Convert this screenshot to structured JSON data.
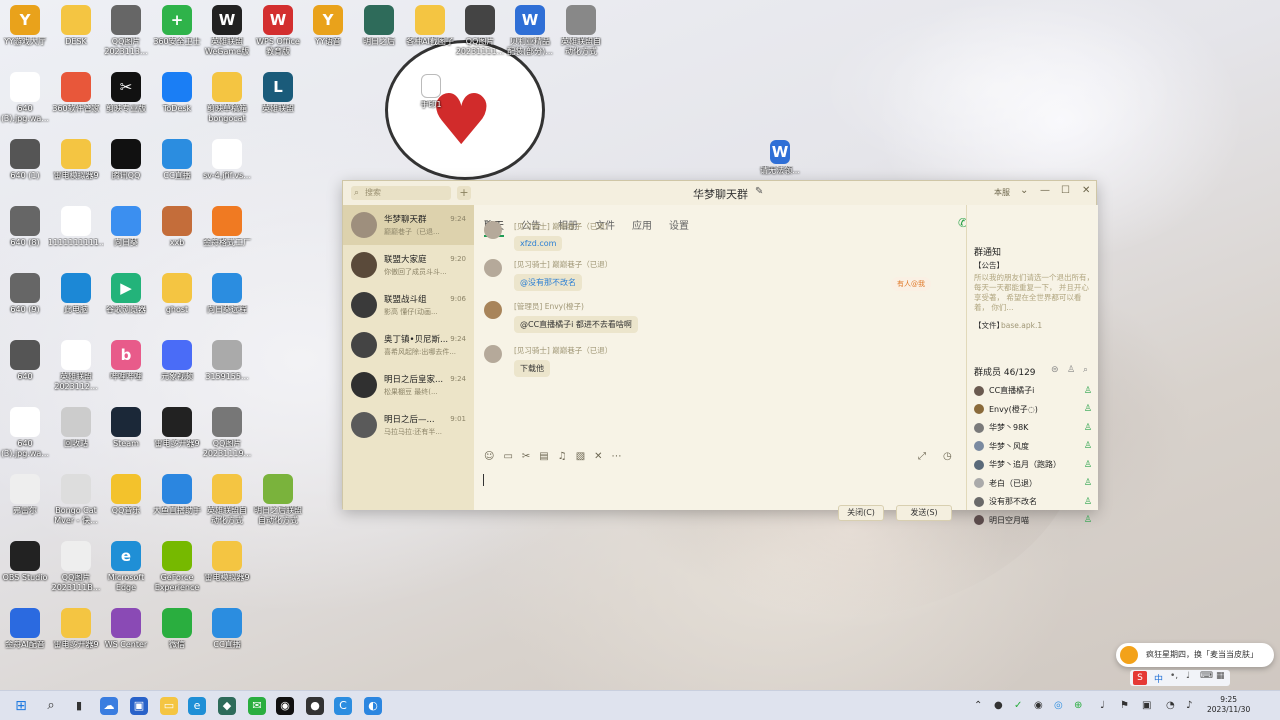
{
  "desktop": {
    "icons": [
      {
        "label": "YY游戏大厅",
        "glyph": "Y",
        "color": "#e9a21b"
      },
      {
        "label": "DESK",
        "glyph": "",
        "color": "#f4c542"
      },
      {
        "label": "QQ图片\n2023113...",
        "glyph": "",
        "color": "#666"
      },
      {
        "label": "360安全卫士",
        "glyph": "+",
        "color": "#2fb34a"
      },
      {
        "label": "英雄联盟WeGame版",
        "glyph": "W",
        "color": "#222"
      },
      {
        "label": "WPS Office\n教育版",
        "glyph": "W",
        "color": "#d32f2f"
      },
      {
        "label": "YY语音",
        "glyph": "Y",
        "color": "#e9a21b"
      },
      {
        "label": "明日之后",
        "glyph": "",
        "color": "#2e6b5a"
      },
      {
        "label": "各种AI截图子",
        "glyph": "",
        "color": "#f4c542"
      },
      {
        "label": "QQ图片\n20231111...",
        "glyph": "",
        "color": "#444"
      },
      {
        "label": "贝利亚精品\n配装(部分)...",
        "glyph": "W",
        "color": "#2f6fd6"
      },
      {
        "label": "英雄联盟自\n动化方式",
        "glyph": "",
        "color": "#888"
      },
      {
        "label": "640\n(3).jpg.wa...",
        "glyph": "",
        "color": "#fff"
      },
      {
        "label": "360软件管家",
        "glyph": "",
        "color": "#e8573a"
      },
      {
        "label": "剪映专业版",
        "glyph": "✂",
        "color": "#111"
      },
      {
        "label": "ToDesk",
        "glyph": "",
        "color": "#1a7ef5"
      },
      {
        "label": "剪映草稿箱\nbongocat",
        "glyph": "",
        "color": "#f4c542"
      },
      {
        "label": "英雄联盟",
        "glyph": "L",
        "color": "#1a5b7a"
      },
      {
        "label": "640 (1)",
        "glyph": "",
        "color": "#555"
      },
      {
        "label": "雷电模拟器9",
        "glyph": "",
        "color": "#f4c542"
      },
      {
        "label": "腾讯QQ",
        "glyph": "",
        "color": "#111"
      },
      {
        "label": "CC直播",
        "glyph": "",
        "color": "#2b8de0"
      },
      {
        "label": "sv-4.jfif.vs...",
        "glyph": "",
        "color": "#fff"
      },
      {
        "label": "640 (8)",
        "glyph": "",
        "color": "#666"
      },
      {
        "label": "1111111111...",
        "glyph": "",
        "color": "#fff"
      },
      {
        "label": "向日葵",
        "glyph": "",
        "color": "#3b8ff0"
      },
      {
        "label": "xxb",
        "glyph": "",
        "color": "#c46d3a"
      },
      {
        "label": "金舟格式工厂",
        "glyph": "",
        "color": "#f07a22"
      },
      {
        "label": "640 (9)",
        "glyph": "",
        "color": "#666"
      },
      {
        "label": "此电脑",
        "glyph": "",
        "color": "#1c88d6"
      },
      {
        "label": "谷歌浏览器",
        "glyph": "▶",
        "color": "#23b37a"
      },
      {
        "label": "ghost",
        "glyph": "",
        "color": "#f4c542"
      },
      {
        "label": "向日葵远程",
        "glyph": "",
        "color": "#2b8de0"
      },
      {
        "label": "640",
        "glyph": "",
        "color": "#555"
      },
      {
        "label": "英雄联盟\n2023112...",
        "glyph": "",
        "color": "#fff"
      },
      {
        "label": "哔哩哔哩",
        "glyph": "b",
        "color": "#e85b8a"
      },
      {
        "label": "元象视频",
        "glyph": "",
        "color": "#4a6cf7"
      },
      {
        "label": "3159155...",
        "glyph": "",
        "color": "#aaa"
      },
      {
        "label": "640\n(3).jpg.wa...",
        "glyph": "",
        "color": "#fff"
      },
      {
        "label": "回收站",
        "glyph": "",
        "color": "#ccc"
      },
      {
        "label": "Steam",
        "glyph": "",
        "color": "#1b2838"
      },
      {
        "label": "雷电多开器9",
        "glyph": "",
        "color": "#222"
      },
      {
        "label": "QQ图片\n20231119...",
        "glyph": "",
        "color": "#777"
      },
      {
        "label": "弗雷尔",
        "glyph": "",
        "color": "#eee"
      },
      {
        "label": "Bongo Cat\nMver - 快...",
        "glyph": "",
        "color": "#ddd"
      },
      {
        "label": "QQ音乐",
        "glyph": "",
        "color": "#f3c22c"
      },
      {
        "label": "大鱼直播助手",
        "glyph": "",
        "color": "#2b86e0"
      },
      {
        "label": "英雄联盟自\n动化方式",
        "glyph": "",
        "color": "#f4c542"
      },
      {
        "label": "明日之后联盟\n自动化方式",
        "glyph": "",
        "color": "#7ab33c"
      },
      {
        "label": "OBS Studio",
        "glyph": "",
        "color": "#222"
      },
      {
        "label": "QQ图片\n2023111B...",
        "glyph": "",
        "color": "#eee"
      },
      {
        "label": "Microsoft\nEdge",
        "glyph": "e",
        "color": "#1f8fd6"
      },
      {
        "label": "GeForce\nExperience",
        "glyph": "",
        "color": "#76b900"
      },
      {
        "label": "雷电模拟器9",
        "glyph": "",
        "color": "#f4c542"
      },
      {
        "label": "金舟AI配音",
        "glyph": "",
        "color": "#2b6ae0"
      },
      {
        "label": "雷电多开器9",
        "glyph": "",
        "color": "#f4c542"
      },
      {
        "label": "WS Center",
        "glyph": "",
        "color": "#8a4ab5"
      },
      {
        "label": "微信",
        "glyph": "",
        "color": "#2aae3f"
      },
      {
        "label": "CC直播",
        "glyph": "",
        "color": "#2b8de0"
      },
      {
        "label": "英雄联盟\nWeGame版",
        "glyph": "",
        "color": "#1a5b7a"
      }
    ],
    "floating_files": [
      {
        "label": "手印1"
      },
      {
        "label": "请无法领..."
      }
    ]
  },
  "chat": {
    "window_title": "华梦聊天群",
    "search_placeholder": "搜索",
    "top_right_label": "本服",
    "conversations": [
      {
        "name": "华梦聊天群",
        "last": "巅巅巷子（已退...",
        "time": "9:24",
        "color": "#9e8f7d"
      },
      {
        "name": "联盟大家庭",
        "last": "你傲回了成员斗斗...",
        "time": "9:20",
        "color": "#5a4a3a"
      },
      {
        "name": "联盟战斗组",
        "last": "影高  懂仔(动画...",
        "time": "9:06",
        "color": "#3a3a3a"
      },
      {
        "name": "奥丁镇•贝尼斯...",
        "last": "喜希风起除:出哪去件...",
        "time": "9:24",
        "color": "#444"
      },
      {
        "name": "明日之后皇家...",
        "last": "松果棚豆   最终(...",
        "time": "9:24",
        "color": "#303030"
      },
      {
        "name": "明日之后—...",
        "last": "马拉马拉:还有半...",
        "time": "9:01",
        "color": "#5a5a5a"
      }
    ],
    "tabs": [
      "聊天",
      "公告",
      "相册",
      "文件",
      "应用",
      "设置"
    ],
    "mention_badge": "有人@我",
    "messages": [
      {
        "sender": "[见习骑士] 巅巅巷子（已退）",
        "text": "xfzd.com"
      },
      {
        "sender": "[见习骑士] 巅巅巷子（已退）",
        "text": "@没有那不改名"
      },
      {
        "sender": "[管理员] Envy(橙子)",
        "text": "@CC直播橘子i 都进不去看啥啊"
      },
      {
        "sender": "[见习骑士] 巅巅巷子（已退）",
        "text": "下载他"
      }
    ],
    "buttons": {
      "close": "关闭(C)",
      "send": "发送(S)"
    },
    "notice": {
      "title": "群通知",
      "announce_label": "【公告】",
      "announce_text": "所以我的朋友们请选一个退出所有，  每天一天都能重复一下，  并且开心享受著，  希望在全世界都可以看着，  你们...",
      "file_label": "【文件】",
      "file_name": "base.apk.1"
    },
    "members_header": "群成员 46/129",
    "members": [
      {
        "name": "CC直播橘子i",
        "color": "#6a5a50"
      },
      {
        "name": "Envy(橙子◌)",
        "color": "#8a6a3a"
      },
      {
        "name": "华梦丶98K",
        "color": "#7a7a7a"
      },
      {
        "name": "华梦丶风度",
        "color": "#7a8aa0"
      },
      {
        "name": "华梦丶追月（跑路）",
        "color": "#5a6a7a"
      },
      {
        "name": "老白（已退）",
        "color": "#aaa"
      },
      {
        "name": "没有那不改名",
        "color": "#6a6a6a"
      },
      {
        "name": "明日空月喵",
        "color": "#5a4a4a"
      }
    ]
  },
  "toast": {
    "text": "疯狂星期四，换「麦当当皮肤」"
  },
  "taskbar": {
    "clock_time": "9:25",
    "clock_date": "2023/11/30",
    "ime_label": "中"
  }
}
